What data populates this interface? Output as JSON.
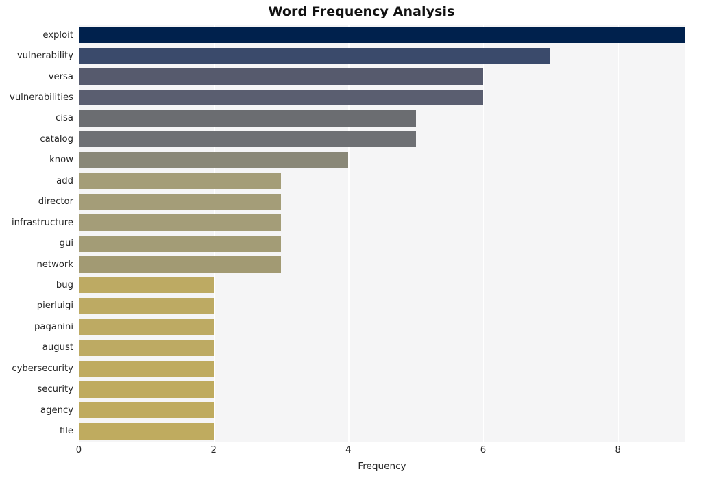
{
  "chart_data": {
    "type": "bar",
    "orientation": "horizontal",
    "title": "Word Frequency Analysis",
    "xlabel": "Frequency",
    "ylabel": "",
    "categories": [
      "exploit",
      "vulnerability",
      "versa",
      "vulnerabilities",
      "cisa",
      "catalog",
      "know",
      "add",
      "director",
      "infrastructure",
      "gui",
      "network",
      "bug",
      "pierluigi",
      "paganini",
      "august",
      "cybersecurity",
      "security",
      "agency",
      "file"
    ],
    "values": [
      9,
      7,
      6,
      6,
      5,
      5,
      4,
      3,
      3,
      3,
      3,
      3,
      2,
      2,
      2,
      2,
      2,
      2,
      2,
      2
    ],
    "bar_colors": [
      "#00214d",
      "#3a4a6b",
      "#565a6d",
      "#5a5e70",
      "#6b6d71",
      "#6e7074",
      "#8a8878",
      "#a49d78",
      "#a49d78",
      "#a49d78",
      "#a39c76",
      "#a29a73",
      "#bdaa63",
      "#bdaa63",
      "#bdaa63",
      "#bdaa63",
      "#bfab60",
      "#bfab5f",
      "#bfab5f",
      "#bfab5f"
    ],
    "xlim": [
      0,
      9
    ],
    "x_ticks": [
      0,
      2,
      4,
      6,
      8
    ],
    "x_tick_labels": [
      "0",
      "2",
      "4",
      "6",
      "8"
    ],
    "grid": "vertical",
    "legend": "none",
    "plot_background": "#f5f5f6",
    "gridline_color": "#ffffff",
    "figure_background": "#ffffff",
    "colormap": "cividis"
  }
}
